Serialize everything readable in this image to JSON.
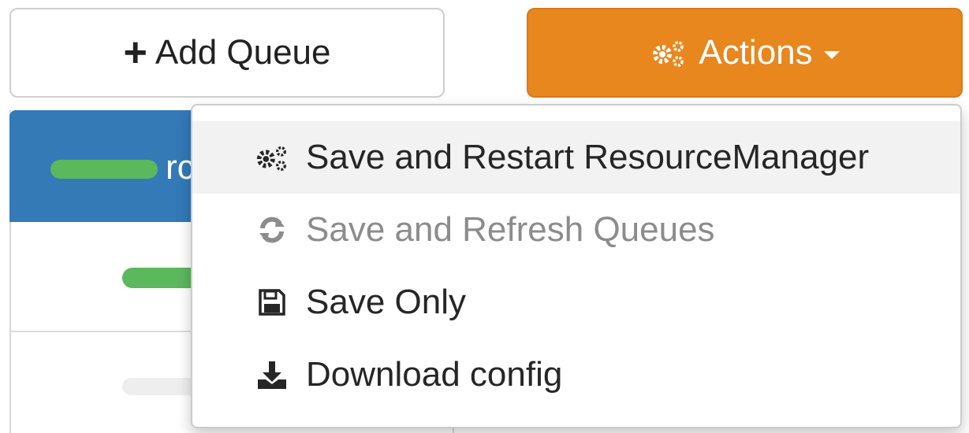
{
  "toolbar": {
    "add_queue_label": "Add Queue",
    "actions_label": "Actions",
    "actions_color": "#e8871e"
  },
  "queue_panel": {
    "root_label_partial": "rc",
    "header_color": "#337ab7",
    "bar_color": "#5cb85c"
  },
  "actions_menu": {
    "items": [
      {
        "label": "Save and Restart ResourceManager",
        "icon": "cogs-icon",
        "state": "hovered"
      },
      {
        "label": "Save and Refresh Queues",
        "icon": "refresh-icon",
        "state": "disabled"
      },
      {
        "label": "Save Only",
        "icon": "floppy-disk-icon",
        "state": "normal"
      },
      {
        "label": "Download config",
        "icon": "download-icon",
        "state": "normal"
      }
    ]
  }
}
